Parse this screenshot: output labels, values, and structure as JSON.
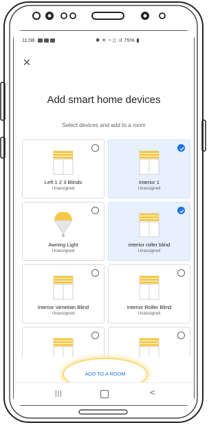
{
  "status_bar": {
    "time": "11:08",
    "right_text": "✱ ✕ ◔ ▯ .ıl 75% ▮"
  },
  "icons": {
    "close": "close-icon",
    "blind": "blind-icon",
    "light": "light-bulb-icon",
    "check": "check-icon"
  },
  "colors": {
    "accent": "#1a73e8",
    "selected_tile_bg": "#e8f0fe",
    "blind_yellow": "#f7c843",
    "highlight": "#f8d05a"
  },
  "header": {
    "title": "Add smart home devices",
    "subtitle": "Select devices and add to a room"
  },
  "devices": [
    {
      "name": "Left 1 2 3 Blinds",
      "room": "Unassigned",
      "selected": false,
      "icon": "blind-icon"
    },
    {
      "name": "Interior 1",
      "room": "Unassigned",
      "selected": true,
      "icon": "blind-icon"
    },
    {
      "name": "Awning Light",
      "room": "Unassigned",
      "selected": false,
      "icon": "light-bulb-icon"
    },
    {
      "name": "interior roller blind",
      "room": "Unassigned",
      "selected": true,
      "icon": "blind-icon"
    },
    {
      "name": "Interior Venetian Blind",
      "room": "Unassigned",
      "selected": false,
      "icon": "blind-icon"
    },
    {
      "name": "Interior Roller Blind",
      "room": "Unassigned",
      "selected": false,
      "icon": "blind-icon"
    },
    {
      "name": "",
      "room": "",
      "selected": false,
      "icon": "blind-icon"
    },
    {
      "name": "",
      "room": "",
      "selected": false,
      "icon": "blind-icon"
    }
  ],
  "actions": {
    "add_to_room": "ADD TO A ROOM"
  },
  "nav": {
    "recents": "|||",
    "back": "<"
  }
}
